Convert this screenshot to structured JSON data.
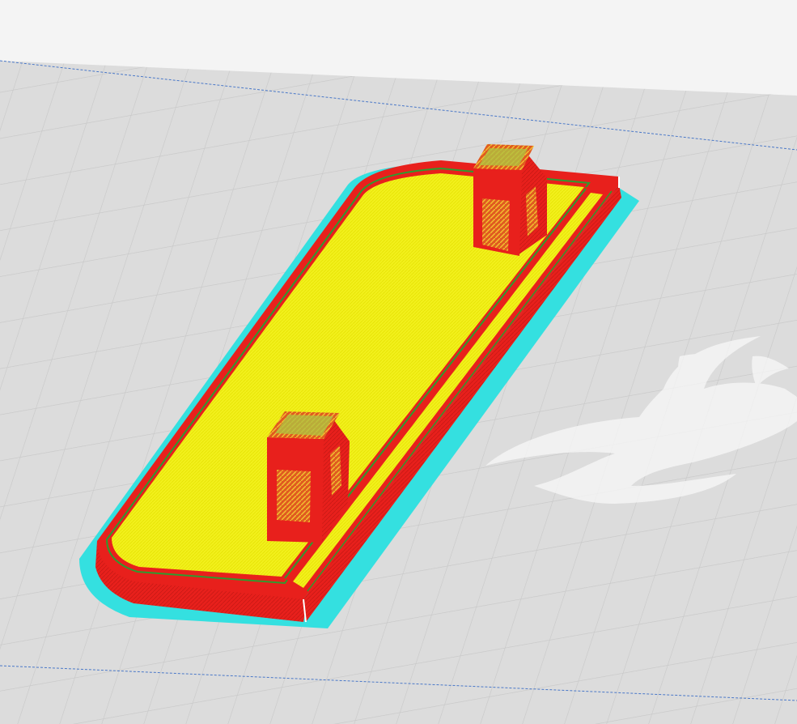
{
  "viewport": {
    "background_color": "#f4f4f4",
    "build_plate_color": "#dcdcdc",
    "grid_color": "#c8c8c8",
    "plate_edge_color": "#4a78c8"
  },
  "legend_colors": {
    "skirt": "#34e0e0",
    "outer_wall": "#e8201c",
    "inner_wall": "#2f9b2f",
    "top_bottom_skin": "#f2f01c",
    "support_infill": "#f08a20"
  },
  "model": {
    "layer_view": true,
    "watermark_icon": "ultimaker-logo-icon"
  }
}
